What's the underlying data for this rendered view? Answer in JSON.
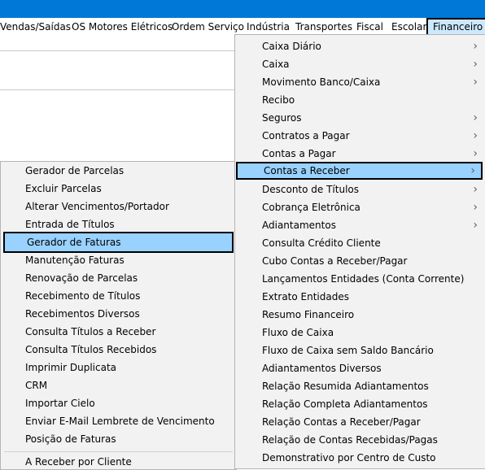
{
  "menubar": {
    "items": [
      "Vendas/Saídas",
      "OS Motores Elétricos",
      "Ordem Serviço",
      "Indústria",
      "Transportes",
      "Fiscal",
      "Escolar",
      "Financeiro"
    ]
  },
  "financeiro_menu": {
    "items": [
      {
        "label": "Caixa Diário",
        "submenu": true
      },
      {
        "label": "Caixa",
        "submenu": true
      },
      {
        "label": "Movimento Banco/Caixa",
        "submenu": true
      },
      {
        "label": "Recibo",
        "submenu": false
      },
      {
        "label": "Seguros",
        "submenu": true
      },
      {
        "label": "Contratos a Pagar",
        "submenu": true
      },
      {
        "label": "Contas a Pagar",
        "submenu": true
      },
      {
        "label": "Contas a Receber",
        "submenu": true
      },
      {
        "label": "Desconto de Títulos",
        "submenu": true
      },
      {
        "label": "Cobrança Eletrônica",
        "submenu": true
      },
      {
        "label": "Adiantamentos",
        "submenu": true
      },
      {
        "label": "Consulta Crédito Cliente",
        "submenu": false
      },
      {
        "label": "Cubo Contas a Receber/Pagar",
        "submenu": false
      },
      {
        "label": "Lançamentos Entidades (Conta Corrente)",
        "submenu": false
      },
      {
        "label": "Extrato Entidades",
        "submenu": false
      },
      {
        "label": "Resumo Financeiro",
        "submenu": false
      },
      {
        "label": "Fluxo de Caixa",
        "submenu": false
      },
      {
        "label": "Fluxo de Caixa sem Saldo Bancário",
        "submenu": false
      },
      {
        "label": "Adiantamentos Diversos",
        "submenu": false
      },
      {
        "label": "Relação Resumida Adiantamentos",
        "submenu": false
      },
      {
        "label": "Relação Completa Adiantamentos",
        "submenu": false
      },
      {
        "label": "Relação Contas a Receber/Pagar",
        "submenu": false
      },
      {
        "label": "Relação de Contas Recebidas/Pagas",
        "submenu": false
      },
      {
        "label": "Demonstrativo por Centro de Custo",
        "submenu": false
      }
    ],
    "arrow_glyph": "›"
  },
  "contas_receber_menu": {
    "items": [
      "Gerador de Parcelas",
      "Excluir Parcelas",
      "Alterar Vencimentos/Portador",
      "Entrada de Títulos",
      "Gerador de Faturas",
      "Manutenção Faturas",
      "Renovação de Parcelas",
      "Recebimento de Títulos",
      "Recebimentos Diversos",
      "Consulta Títulos a Receber",
      "Consulta Títulos Recebidos",
      "Imprimir Duplicata",
      "CRM",
      "Importar Cielo",
      "Enviar E-Mail Lembrete de Vencimento",
      "Posição de Faturas",
      "A Receber por Cliente"
    ]
  },
  "colors": {
    "titlebar": "#0078d7",
    "highlight": "#99d1ff",
    "menubar_active": "#cce8ff"
  }
}
